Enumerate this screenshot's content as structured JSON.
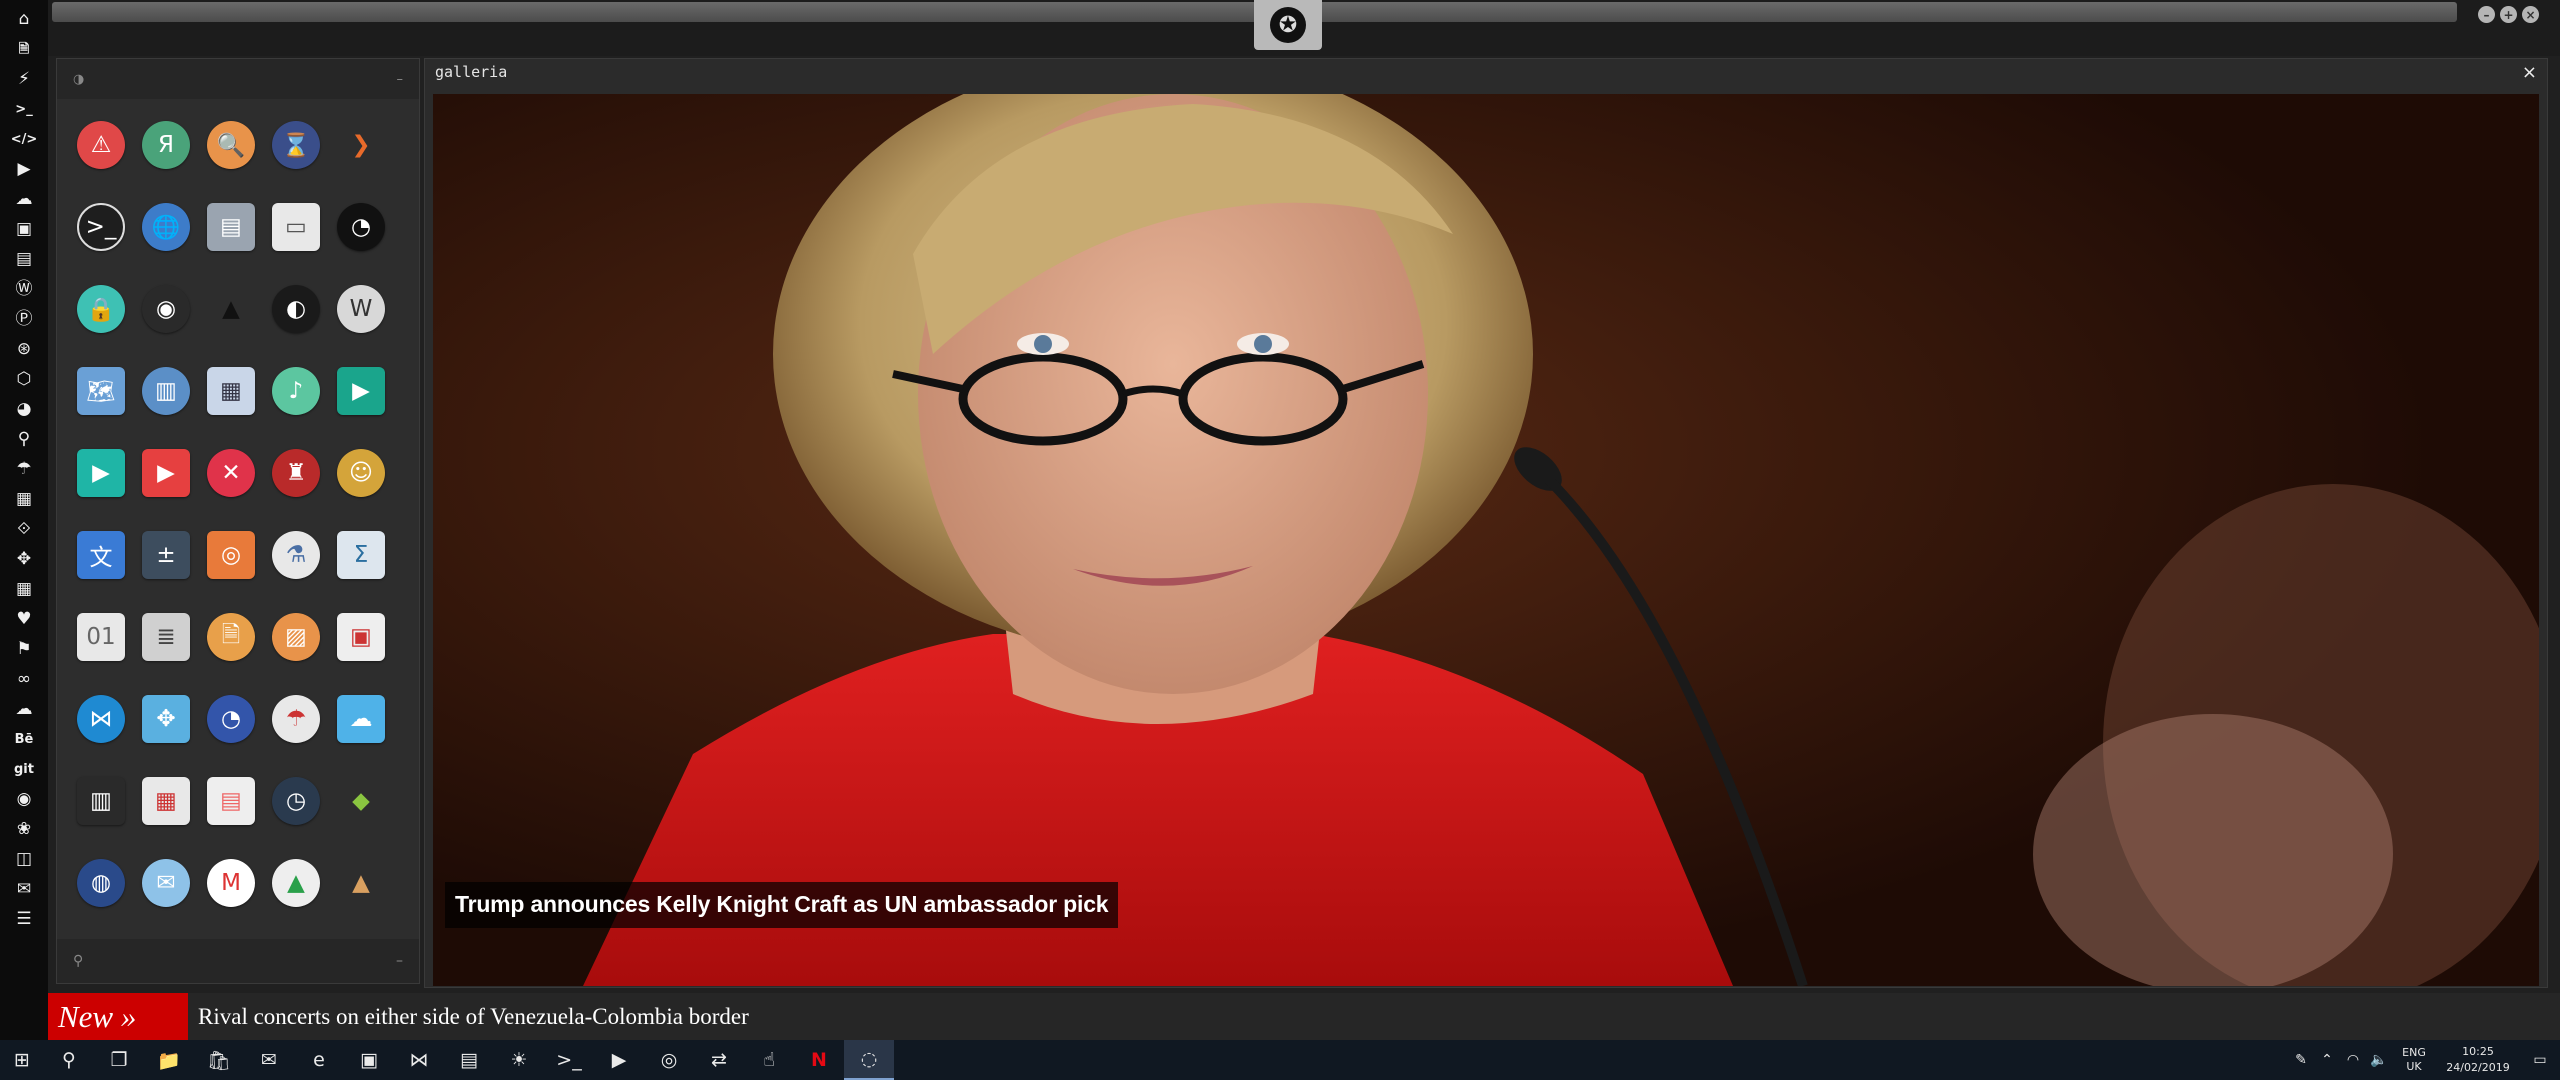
{
  "leftbar": {
    "icons": [
      {
        "name": "home-icon",
        "glyph": "⌂"
      },
      {
        "name": "document-icon",
        "glyph": "🗎"
      },
      {
        "name": "lightning-icon",
        "glyph": "⚡"
      },
      {
        "name": "terminal-icon",
        "glyph": ">_"
      },
      {
        "name": "code-icon",
        "glyph": "</>"
      },
      {
        "name": "play-circle-icon",
        "glyph": "▶"
      },
      {
        "name": "cloud-icon",
        "glyph": "☁"
      },
      {
        "name": "image-icon",
        "glyph": "▣"
      },
      {
        "name": "newspaper-icon",
        "glyph": "▤"
      },
      {
        "name": "wordpress-icon",
        "glyph": "Ⓦ"
      },
      {
        "name": "pinterest-icon",
        "glyph": "Ⓟ"
      },
      {
        "name": "settings-circle-icon",
        "glyph": "⊛"
      },
      {
        "name": "hexagon-icon",
        "glyph": "⬡"
      },
      {
        "name": "globe-icon",
        "glyph": "◕"
      },
      {
        "name": "search-icon",
        "glyph": "⚲"
      },
      {
        "name": "umbrella-icon",
        "glyph": "☂"
      },
      {
        "name": "contact-icon",
        "glyph": "▦"
      },
      {
        "name": "link-icon",
        "glyph": "⟐"
      },
      {
        "name": "expand-icon",
        "glyph": "✥"
      },
      {
        "name": "youtube-icon",
        "glyph": "▦"
      },
      {
        "name": "heart-icon",
        "glyph": "♥"
      },
      {
        "name": "flag-icon",
        "glyph": "⚑"
      },
      {
        "name": "infinity-icon",
        "glyph": "∞"
      },
      {
        "name": "cloud-alt-icon",
        "glyph": "☁"
      },
      {
        "name": "behance-icon",
        "glyph": "Bē"
      },
      {
        "name": "git-icon",
        "glyph": "git"
      },
      {
        "name": "github-icon",
        "glyph": "◉"
      },
      {
        "name": "cluster-icon",
        "glyph": "❀"
      },
      {
        "name": "map-icon",
        "glyph": "◫"
      },
      {
        "name": "mail-icon",
        "glyph": "✉"
      },
      {
        "name": "list-icon",
        "glyph": "☰"
      }
    ]
  },
  "topbar": {
    "logo_glyph": "✪",
    "controls": [
      {
        "name": "minimize-button",
        "glyph": "–"
      },
      {
        "name": "maximize-button",
        "glyph": "+"
      },
      {
        "name": "close-button",
        "glyph": "×"
      }
    ]
  },
  "launcher": {
    "header_icon": "◑",
    "header_action": "–",
    "footer_search_icon": "⚲",
    "footer_action": "–",
    "apps": [
      {
        "name": "warning-app-icon",
        "glyph": "⚠",
        "bg": "#e04848"
      },
      {
        "name": "yandex-app-icon",
        "glyph": "Я",
        "bg": "#4aa37a"
      },
      {
        "name": "search-app-icon",
        "glyph": "🔍",
        "bg": "#e8934a"
      },
      {
        "name": "hourglass-app-icon",
        "glyph": "⌛",
        "bg": "#3a4e8a"
      },
      {
        "name": "chevron-app-icon",
        "glyph": "❯",
        "bg": "transparent",
        "color": "#e86a2a"
      },
      {
        "name": "terminal-app-icon",
        "glyph": ">_",
        "bg": "#1e1e1e",
        "border": "#ddd"
      },
      {
        "name": "globe-app-icon",
        "glyph": "🌐",
        "bg": "#3d7cc9"
      },
      {
        "name": "storage-app-icon",
        "glyph": "▤",
        "bg": "#9aa4b0",
        "square": true
      },
      {
        "name": "window-app-icon",
        "glyph": "▭",
        "bg": "#e8e8e8",
        "color": "#555",
        "square": true
      },
      {
        "name": "steam-app-icon",
        "glyph": "◔",
        "bg": "#111"
      },
      {
        "name": "vpn-app-icon",
        "glyph": "🔒",
        "bg": "#3ec1b4"
      },
      {
        "name": "github-app-icon",
        "glyph": "◉",
        "bg": "#2a2a2a"
      },
      {
        "name": "starfleet-app-icon",
        "glyph": "▲",
        "bg": "transparent",
        "color": "#111"
      },
      {
        "name": "deathstar-app-icon",
        "glyph": "◐",
        "bg": "#1a1a1a"
      },
      {
        "name": "wikipedia-app-icon",
        "glyph": "W",
        "bg": "#d8d8d8",
        "color": "#333"
      },
      {
        "name": "maps-app-icon",
        "glyph": "🗺",
        "bg": "#6aa0d6",
        "square": true
      },
      {
        "name": "books-app-icon",
        "glyph": "▥",
        "bg": "#5b8fc7"
      },
      {
        "name": "notebook-app-icon",
        "glyph": "▦",
        "bg": "#c9d6e8",
        "color": "#334",
        "square": true
      },
      {
        "name": "music-app-icon",
        "glyph": "♪",
        "bg": "#5cc6a0"
      },
      {
        "name": "video-app-icon",
        "glyph": "▶",
        "bg": "#1aa58c",
        "square": true
      },
      {
        "name": "media-player-app-icon",
        "glyph": "▶",
        "bg": "#1fb5a6",
        "square": true
      },
      {
        "name": "youtube-app-icon",
        "glyph": "▶",
        "bg": "#e64040",
        "square": true
      },
      {
        "name": "close-app-icon",
        "glyph": "✕",
        "bg": "#e0334a"
      },
      {
        "name": "ironman-app-icon",
        "glyph": "♜",
        "bg": "#b92a2a"
      },
      {
        "name": "c3po-app-icon",
        "glyph": "☺",
        "bg": "#d4a43a"
      },
      {
        "name": "translate-app-icon",
        "glyph": "文",
        "bg": "#3a7bd5",
        "square": true
      },
      {
        "name": "calculator-app-icon",
        "glyph": "±",
        "bg": "#3d4d5e",
        "square": true
      },
      {
        "name": "photos-app-icon",
        "glyph": "◎",
        "bg": "#e87a3a",
        "square": true
      },
      {
        "name": "chemistry-app-icon",
        "glyph": "⚗",
        "bg": "#e8e8e8",
        "color": "#4a6fa5"
      },
      {
        "name": "sigma-app-icon",
        "glyph": "Σ",
        "bg": "#dde6ee",
        "color": "#2a6fa0",
        "square": true
      },
      {
        "name": "binary-file-app-icon",
        "glyph": "01",
        "bg": "#e8e8e8",
        "color": "#666",
        "square": true
      },
      {
        "name": "text-editor-app-icon",
        "glyph": "≣",
        "bg": "#d0d0d0",
        "color": "#444",
        "square": true
      },
      {
        "name": "document-app-icon",
        "glyph": "🗎",
        "bg": "#e8a04a"
      },
      {
        "name": "image-viewer-app-icon",
        "glyph": "▨",
        "bg": "#e8934a"
      },
      {
        "name": "presentation-app-icon",
        "glyph": "▣",
        "bg": "#eee",
        "color": "#c33",
        "square": true
      },
      {
        "name": "vscode-app-icon",
        "glyph": "⋈",
        "bg": "#1f8ad2"
      },
      {
        "name": "network-app-icon",
        "glyph": "✥",
        "bg": "#5ab0e0",
        "square": true
      },
      {
        "name": "disk-app-icon",
        "glyph": "◔",
        "bg": "#3355aa"
      },
      {
        "name": "weather-umbrella-app-icon",
        "glyph": "☂",
        "bg": "#e8e8e8",
        "color": "#c33"
      },
      {
        "name": "weather-app-icon",
        "glyph": "☁",
        "bg": "#4fb2e8",
        "square": true
      },
      {
        "name": "equalizer-app-icon",
        "glyph": "▥",
        "bg": "#2a2a2a",
        "square": true
      },
      {
        "name": "calendar-app-icon",
        "glyph": "▦",
        "bg": "#e8e8e8",
        "color": "#c33",
        "square": true
      },
      {
        "name": "schedule-app-icon",
        "glyph": "▤",
        "bg": "#eee",
        "color": "#e66",
        "square": true
      },
      {
        "name": "clock-app-icon",
        "glyph": "◷",
        "bg": "#2a3a4e"
      },
      {
        "name": "colorpicker-app-icon",
        "glyph": "◆",
        "bg": "transparent",
        "color": "#8ac540"
      },
      {
        "name": "earth-app-icon",
        "glyph": "◍",
        "bg": "#2a4a8a"
      },
      {
        "name": "email-app-icon",
        "glyph": "✉",
        "bg": "#8ec2e8"
      },
      {
        "name": "gmail-app-icon",
        "glyph": "M",
        "bg": "#fff",
        "color": "#d33"
      },
      {
        "name": "drive-app-icon",
        "glyph": "▲",
        "bg": "#eee",
        "color": "#2aa04a"
      },
      {
        "name": "pyramid-app-icon",
        "glyph": "▲",
        "bg": "transparent",
        "color": "#d9a060"
      }
    ]
  },
  "gallery": {
    "title": "galleria",
    "close_glyph": "×",
    "caption": "Trump announces Kelly Knight Craft as UN ambassador pick"
  },
  "ticker": {
    "label": "New »",
    "headline": "Rival concerts on either side of Venezuela-Colombia border"
  },
  "taskbar": {
    "icons": [
      {
        "name": "start-icon",
        "glyph": "⊞"
      },
      {
        "name": "search-icon",
        "glyph": "⚲"
      },
      {
        "name": "task-view-icon",
        "glyph": "❐"
      },
      {
        "name": "file-explorer-icon",
        "glyph": "📁"
      },
      {
        "name": "store-icon",
        "glyph": "🛍"
      },
      {
        "name": "mail-icon",
        "glyph": "✉"
      },
      {
        "name": "edge-icon",
        "glyph": "e"
      },
      {
        "name": "app-blue-icon",
        "glyph": "▣"
      },
      {
        "name": "vscode-icon",
        "glyph": "⋈"
      },
      {
        "name": "news-icon",
        "glyph": "▤"
      },
      {
        "name": "weather-icon",
        "glyph": "☀"
      },
      {
        "name": "terminal-icon",
        "glyph": ">_"
      },
      {
        "name": "powershell-icon",
        "glyph": "▶"
      },
      {
        "name": "chrome-icon",
        "glyph": "◎"
      },
      {
        "name": "remote-desktop-icon",
        "glyph": "⇄"
      },
      {
        "name": "pointer-icon",
        "glyph": "☝"
      },
      {
        "name": "netflix-icon",
        "glyph": "N"
      },
      {
        "name": "rainmeter-icon",
        "glyph": "◌",
        "active": true
      }
    ],
    "tray": {
      "people_icon": "✎",
      "chevron_icon": "⌃",
      "network_icon": "◠",
      "volume_icon": "🔈",
      "lang_line1": "ENG",
      "lang_line2": "UK",
      "time": "10:25",
      "date": "24/02/2019",
      "notification_icon": "▭"
    }
  }
}
